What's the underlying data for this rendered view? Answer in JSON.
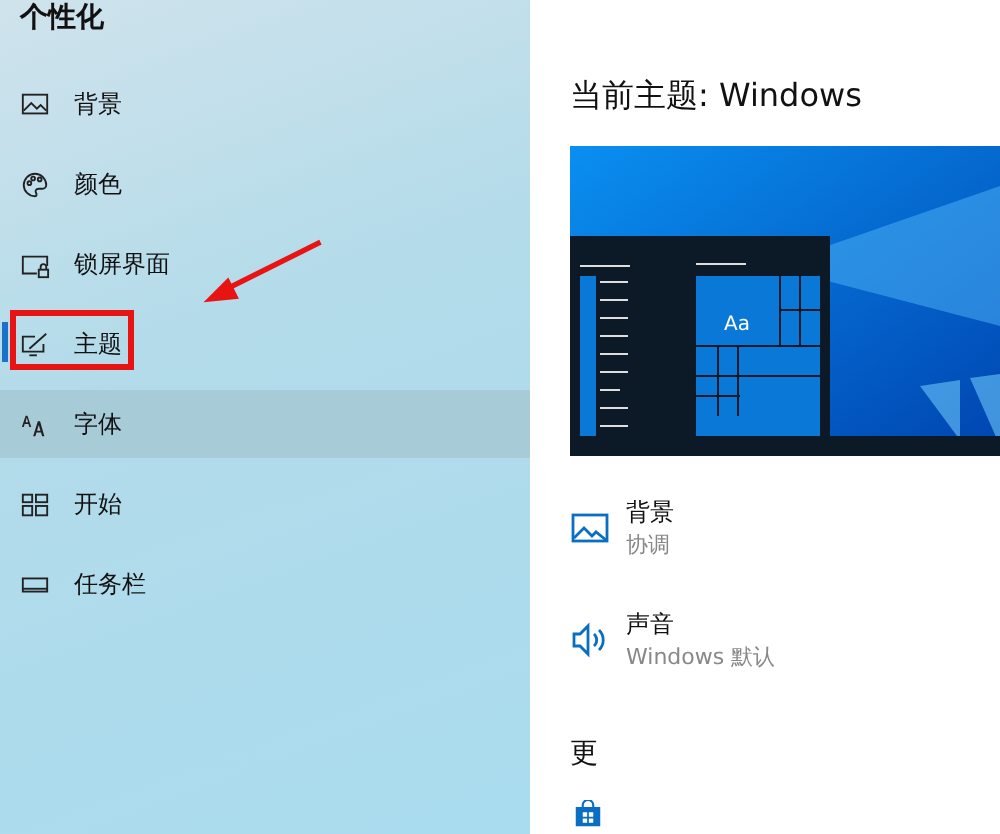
{
  "sidebar": {
    "title": "个性化",
    "items": [
      {
        "label": "背景",
        "kind": "image",
        "selected": false,
        "hovered": false
      },
      {
        "label": "颜色",
        "kind": "palette",
        "selected": false,
        "hovered": false
      },
      {
        "label": "锁屏界面",
        "kind": "lock",
        "selected": false,
        "hovered": false
      },
      {
        "label": "主题",
        "kind": "theme",
        "selected": true,
        "hovered": false,
        "highlighted": true
      },
      {
        "label": "字体",
        "kind": "font",
        "selected": false,
        "hovered": true
      },
      {
        "label": "开始",
        "kind": "start",
        "selected": false,
        "hovered": false
      },
      {
        "label": "任务栏",
        "kind": "taskbar",
        "selected": false,
        "hovered": false
      }
    ]
  },
  "main": {
    "heading": "当前主题: Windows",
    "preview": {
      "tile_text": "Aa"
    },
    "settings": [
      {
        "kind": "image",
        "title": "背景",
        "value": "协调"
      },
      {
        "kind": "sound",
        "title": "声音",
        "value": "Windows 默认"
      }
    ],
    "section_heading": "更"
  }
}
